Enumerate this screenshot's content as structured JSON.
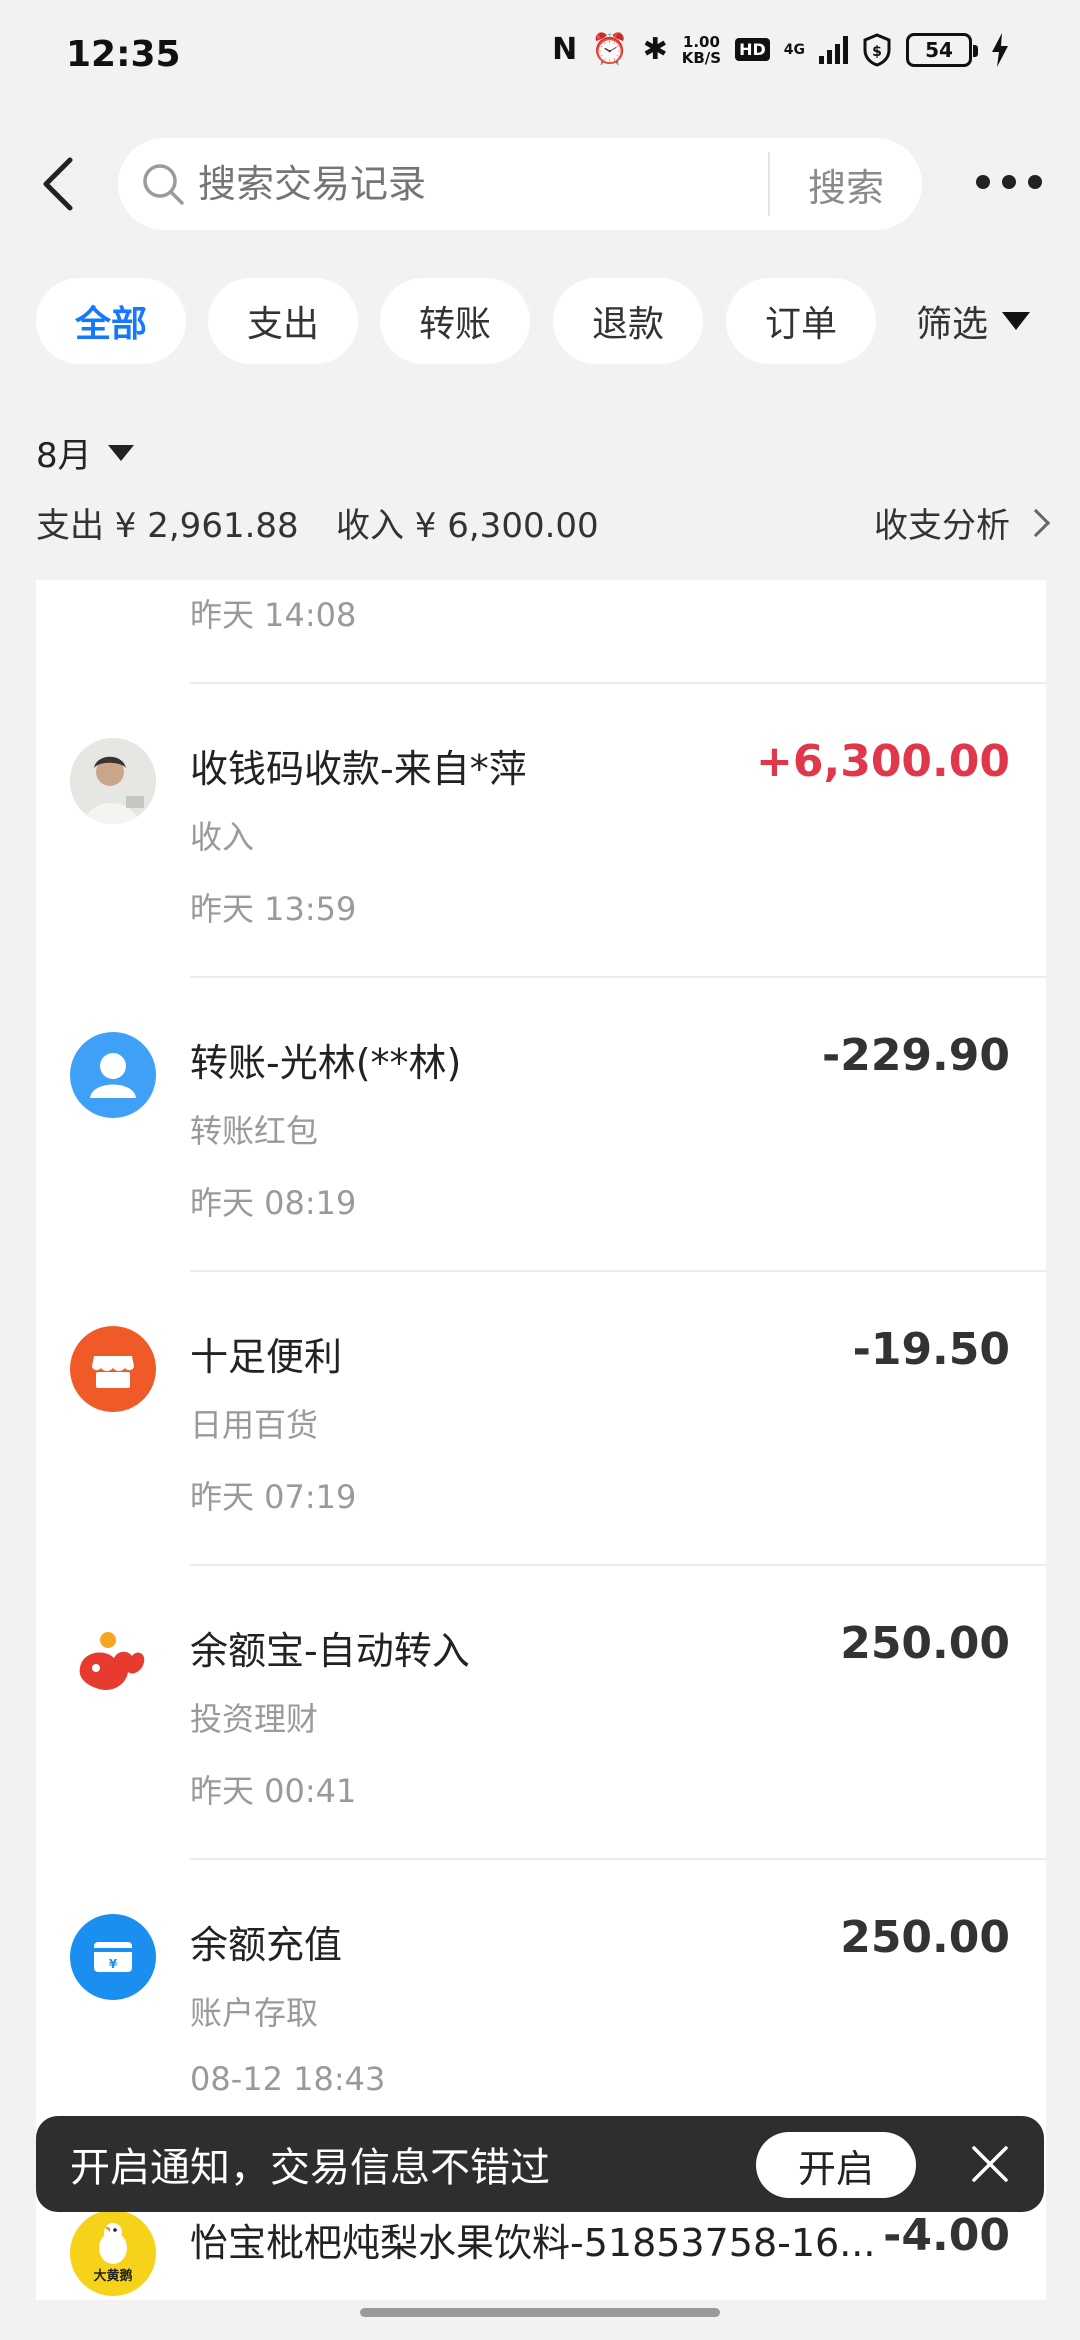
{
  "status_bar": {
    "time": "12:35",
    "nfc": "N",
    "alarm": "⏰",
    "bluetooth": "✱",
    "speed_value": "1.00",
    "speed_unit": "KB/S",
    "hd": "HD",
    "network": "4G",
    "battery": "54"
  },
  "header": {
    "search_placeholder": "搜索交易记录",
    "search_button": "搜索"
  },
  "filters": {
    "tabs": [
      "全部",
      "支出",
      "转账",
      "退款",
      "订单"
    ],
    "more": "筛选"
  },
  "summary": {
    "month": "8月",
    "spend": "支出 ¥ 2,961.88",
    "income": "收入 ¥ 6,300.00",
    "analysis": "收支分析"
  },
  "transactions": [
    {
      "title": "",
      "category": "",
      "time": "昨天 14:08",
      "amount": ""
    },
    {
      "title": "收钱码收款-来自*萍",
      "category": "收入",
      "time": "昨天 13:59",
      "amount": "+6,300.00"
    },
    {
      "title": "转账-光林(**林)",
      "category": "转账红包",
      "time": "昨天 08:19",
      "amount": "-229.90"
    },
    {
      "title": "十足便利",
      "category": "日用百货",
      "time": "昨天 07:19",
      "amount": "-19.50"
    },
    {
      "title": "余额宝-自动转入",
      "category": "投资理财",
      "time": "昨天 00:41",
      "amount": "250.00"
    },
    {
      "title": "余额充值",
      "category": "账户存取",
      "time": "08-12 18:43",
      "amount": "250.00"
    },
    {
      "title": "怡宝枇杷炖梨水果饮料-51853758-16...",
      "category": "",
      "time": "",
      "amount": "-4.00",
      "icon_text": "大黄鹅"
    }
  ],
  "notification": {
    "text": "开启通知，交易信息不错过",
    "button": "开启"
  },
  "colors": {
    "accent": "#1677ff",
    "income": "#e0384a",
    "transfer_icon": "#3ea0f6",
    "store_icon": "#f05a28",
    "yuebao_icon": "#e63b2e",
    "recharge_icon": "#1a8ff0",
    "snack_icon": "#f7d21a"
  }
}
